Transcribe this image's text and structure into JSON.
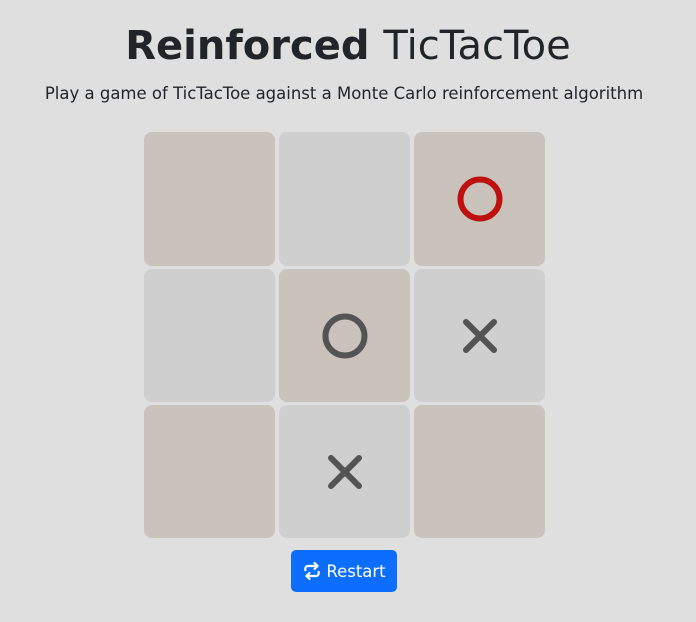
{
  "header": {
    "title_bold": "Reinforced",
    "title_rest": "TicTacToe",
    "subtitle": "Play a game of TicTacToe against a Monte Carlo reinforcement algorithm"
  },
  "board": {
    "cells": [
      {
        "mark": "",
        "shade": "tan",
        "highlight": false
      },
      {
        "mark": "",
        "shade": "grey",
        "highlight": false
      },
      {
        "mark": "O",
        "shade": "tan",
        "highlight": true
      },
      {
        "mark": "",
        "shade": "grey",
        "highlight": false
      },
      {
        "mark": "O",
        "shade": "tan",
        "highlight": false
      },
      {
        "mark": "X",
        "shade": "grey",
        "highlight": false
      },
      {
        "mark": "",
        "shade": "tan",
        "highlight": false
      },
      {
        "mark": "X",
        "shade": "grey",
        "highlight": false
      },
      {
        "mark": "",
        "shade": "tan",
        "highlight": false
      }
    ]
  },
  "restart": {
    "label": "Restart",
    "icon": "repeat-icon"
  },
  "colors": {
    "background": "#dfdfdf",
    "cell_tan": "#cac3bc",
    "cell_grey": "#cfcfcf",
    "mark_default": "#545454",
    "mark_highlight": "#bf1010",
    "button": "#0d6efd"
  }
}
